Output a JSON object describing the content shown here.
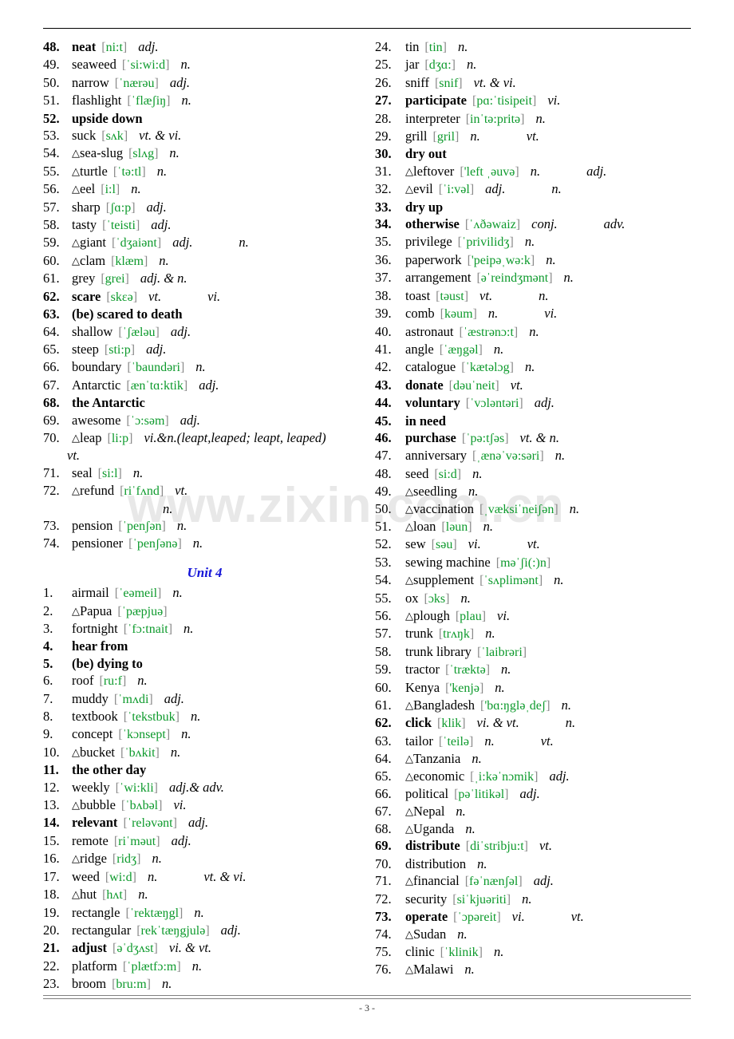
{
  "page": {
    "footer_number": "- 3 -",
    "watermark": "www.zixin.com.cn",
    "unit_heading": "Unit 4",
    "accent_green": "#0d9a2c",
    "bracket_gray": "#8a8a8a",
    "unit_blue": "#1414d8"
  },
  "left_column": [
    {
      "num": "48.",
      "tri": false,
      "bold": true,
      "word": "neat",
      "phon": "[ni:t]",
      "pos": "adj."
    },
    {
      "num": "49.",
      "tri": false,
      "bold": false,
      "word": "seaweed",
      "phon": "[ˈsi:wi:d]",
      "pos": "n."
    },
    {
      "num": "50.",
      "tri": false,
      "bold": false,
      "word": "narrow",
      "phon": "[ˈnærəu]",
      "pos": "adj."
    },
    {
      "num": "51.",
      "tri": false,
      "bold": false,
      "word": "flashlight",
      "phon": "[ˈflæʃiŋ]",
      "pos": "n."
    },
    {
      "num": "52.",
      "tri": false,
      "bold": true,
      "word": "upside down",
      "phon": "",
      "pos": ""
    },
    {
      "num": "53.",
      "tri": false,
      "bold": false,
      "word": "suck",
      "phon": "[sʌk]",
      "pos": "vt. & vi."
    },
    {
      "num": "54.",
      "tri": true,
      "bold": false,
      "word": "sea-slug",
      "phon": "[slʌg]",
      "pos": "n."
    },
    {
      "num": "55.",
      "tri": true,
      "bold": false,
      "word": "turtle",
      "phon": "[ˈtə:tl]",
      "pos": "n."
    },
    {
      "num": "56.",
      "tri": true,
      "bold": false,
      "word": "eel",
      "phon": "[i:l]",
      "pos": "n."
    },
    {
      "num": "57.",
      "tri": false,
      "bold": false,
      "word": "sharp",
      "phon": "[ʃɑ:p]",
      "pos": "adj."
    },
    {
      "num": "58.",
      "tri": false,
      "bold": false,
      "word": "tasty",
      "phon": "[ˈteisti]",
      "pos": "adj."
    },
    {
      "num": "59.",
      "tri": true,
      "bold": false,
      "word": "giant",
      "phon": "[ˈdʒaiənt]",
      "pos": "adj.",
      "pos2": "n."
    },
    {
      "num": "60.",
      "tri": true,
      "bold": false,
      "word": "clam",
      "phon": "[klæm]",
      "pos": "n."
    },
    {
      "num": "61.",
      "tri": false,
      "bold": false,
      "word": "grey",
      "phon": "[grei]",
      "pos": "adj. & n."
    },
    {
      "num": "62.",
      "tri": false,
      "bold": true,
      "word": "scare",
      "phon": "[skɛə]",
      "pos": "vt.",
      "pos2": "vi."
    },
    {
      "num": "63.",
      "tri": false,
      "bold": true,
      "word": "(be) scared to death",
      "phon": "",
      "pos": ""
    },
    {
      "num": "64.",
      "tri": false,
      "bold": false,
      "word": "shallow",
      "phon": "[ˈʃæləu]",
      "pos": "adj."
    },
    {
      "num": "65.",
      "tri": false,
      "bold": false,
      "word": "steep",
      "phon": "[sti:p]",
      "pos": "adj."
    },
    {
      "num": "66.",
      "tri": false,
      "bold": false,
      "word": "boundary",
      "phon": "[ˈbaundəri]",
      "pos": "n."
    },
    {
      "num": "67.",
      "tri": false,
      "bold": false,
      "word": "Antarctic",
      "phon": "[ænˈtɑ:ktik]",
      "pos": "adj."
    },
    {
      "num": "68.",
      "tri": false,
      "bold": true,
      "word": "the Antarctic",
      "phon": "",
      "pos": ""
    },
    {
      "num": "69.",
      "tri": false,
      "bold": false,
      "word": "awesome",
      "phon": "[ˈɔ:səm]",
      "pos": "adj."
    },
    {
      "num": "70.",
      "tri": true,
      "bold": false,
      "word": "leap",
      "phon": "[li:p]",
      "pos": "vi.&n.(leapt,leaped; leapt, leaped)",
      "cont": "vt.",
      "cont_indent": "i1"
    },
    {
      "num": "71.",
      "tri": false,
      "bold": false,
      "word": "seal",
      "phon": "[si:l]",
      "pos": "n."
    },
    {
      "num": "72.",
      "tri": true,
      "bold": false,
      "word": "refund",
      "phon": "[riˈfʌnd]",
      "pos": "vt.",
      "cont": "n.",
      "cont_indent": "i2"
    },
    {
      "num": "73.",
      "tri": false,
      "bold": false,
      "word": "pension",
      "phon": "[ˈpenʃən]",
      "pos": "n."
    },
    {
      "num": "74.",
      "tri": false,
      "bold": false,
      "word": "pensioner",
      "phon": "[ˈpenʃənə]",
      "pos": "n."
    }
  ],
  "left_column_unit4": [
    {
      "num": "1.",
      "tri": false,
      "bold": false,
      "word": "airmail",
      "phon": "[ˈeəmeil]",
      "pos": "n."
    },
    {
      "num": "2.",
      "tri": true,
      "bold": false,
      "word": "Papua",
      "phon": "[ˈpæpjuə]",
      "pos": ""
    },
    {
      "num": "3.",
      "tri": false,
      "bold": false,
      "word": "fortnight",
      "phon": "[ˈfɔ:tnait]",
      "pos": "n."
    },
    {
      "num": "4.",
      "tri": false,
      "bold": true,
      "word": "hear from",
      "phon": "",
      "pos": ""
    },
    {
      "num": "5.",
      "tri": false,
      "bold": true,
      "word": "(be) dying to",
      "phon": "",
      "pos": ""
    },
    {
      "num": "6.",
      "tri": false,
      "bold": false,
      "word": "roof",
      "phon": "[ru:f]",
      "pos": "n."
    },
    {
      "num": "7.",
      "tri": false,
      "bold": false,
      "word": "muddy",
      "phon": "[ˈmʌdi]",
      "pos": "adj."
    },
    {
      "num": "8.",
      "tri": false,
      "bold": false,
      "word": "textbook",
      "phon": "[ˈtekstbuk]",
      "pos": "n."
    },
    {
      "num": "9.",
      "tri": false,
      "bold": false,
      "word": "concept",
      "phon": "[ˈkɔnsept]",
      "pos": "n."
    },
    {
      "num": "10.",
      "tri": true,
      "bold": false,
      "word": "bucket",
      "phon": "[ˈbʌkit]",
      "pos": "n."
    },
    {
      "num": "11.",
      "tri": false,
      "bold": true,
      "word": "the other day",
      "phon": "",
      "pos": ""
    },
    {
      "num": "12.",
      "tri": false,
      "bold": false,
      "word": "weekly",
      "phon": "[ˈwi:kli]",
      "pos": "adj.& adv."
    },
    {
      "num": "13.",
      "tri": true,
      "bold": false,
      "word": "bubble",
      "phon": "[ˈbʌbəl]",
      "pos": "vi."
    },
    {
      "num": "14.",
      "tri": false,
      "bold": true,
      "word": "relevant",
      "phon": "[ˈreləvənt]",
      "pos": "adj."
    },
    {
      "num": "15.",
      "tri": false,
      "bold": false,
      "word": "remote",
      "phon": "[riˈməut]",
      "pos": "adj."
    },
    {
      "num": "16.",
      "tri": true,
      "bold": false,
      "word": "ridge",
      "phon": "[ridʒ]",
      "pos": "n."
    },
    {
      "num": "17.",
      "tri": false,
      "bold": false,
      "word": "weed",
      "phon": "[wi:d]",
      "pos": "n.",
      "pos2": "vt. & vi."
    },
    {
      "num": "18.",
      "tri": true,
      "bold": false,
      "word": "hut",
      "phon": "[hʌt]",
      "pos": "n."
    },
    {
      "num": "19.",
      "tri": false,
      "bold": false,
      "word": "rectangle",
      "phon": "[ˈrektæŋgl]",
      "pos": "n."
    },
    {
      "num": "20.",
      "tri": false,
      "bold": false,
      "word": "rectangular",
      "phon": "[rekˈtæŋgjulə]",
      "pos": "adj."
    },
    {
      "num": "21.",
      "tri": false,
      "bold": true,
      "word": "adjust",
      "phon": "[əˈdʒʌst]",
      "pos": "vi. & vt."
    },
    {
      "num": "22.",
      "tri": false,
      "bold": false,
      "word": "platform",
      "phon": "[ˈplætfɔ:m]",
      "pos": "n."
    },
    {
      "num": "23.",
      "tri": false,
      "bold": false,
      "word": "broom",
      "phon": "[bru:m]",
      "pos": "n."
    }
  ],
  "right_column": [
    {
      "num": "24.",
      "tri": false,
      "bold": false,
      "word": "tin",
      "phon": "[tin]",
      "pos": "n."
    },
    {
      "num": "25.",
      "tri": false,
      "bold": false,
      "word": "jar",
      "phon": "[dʒɑ:]",
      "pos": "n."
    },
    {
      "num": "26.",
      "tri": false,
      "bold": false,
      "word": "sniff",
      "phon": "[snif]",
      "pos": "vt. & vi."
    },
    {
      "num": "27.",
      "tri": false,
      "bold": true,
      "word": "participate",
      "phon": "[pɑ:ˈtisipeit]",
      "pos": "vi."
    },
    {
      "num": "28.",
      "tri": false,
      "bold": false,
      "word": "interpreter",
      "phon": "[inˈtə:pritə]",
      "pos": "n."
    },
    {
      "num": "29.",
      "tri": false,
      "bold": false,
      "word": "grill",
      "phon": "[gril]",
      "pos": "n.",
      "pos2": "vt."
    },
    {
      "num": "30.",
      "tri": false,
      "bold": true,
      "word": "dry   out",
      "phon": "",
      "pos": ""
    },
    {
      "num": "31.",
      "tri": true,
      "bold": false,
      "word": "leftover",
      "phon": "['left ˌəuvə]",
      "pos": "n.",
      "pos2": "adj."
    },
    {
      "num": "32.",
      "tri": true,
      "bold": false,
      "word": "evil",
      "phon": "[ˈi:vəl]",
      "pos": "adj.",
      "pos2": "n."
    },
    {
      "num": "33.",
      "tri": false,
      "bold": true,
      "word": "dry up",
      "phon": "",
      "pos": ""
    },
    {
      "num": "34.",
      "tri": false,
      "bold": true,
      "word": "otherwise",
      "phon": "[ˈʌðəwaiz]",
      "pos": "conj.",
      "pos2": "adv."
    },
    {
      "num": "35.",
      "tri": false,
      "bold": false,
      "word": "privilege",
      "phon": "[ˈprivilidʒ]",
      "pos": "n."
    },
    {
      "num": "36.",
      "tri": false,
      "bold": false,
      "word": "paperwork",
      "phon": "['peipəˌwə:k]",
      "pos": "n."
    },
    {
      "num": "37.",
      "tri": false,
      "bold": false,
      "word": "arrangement",
      "phon": "[əˈreindʒmənt]",
      "pos": "n."
    },
    {
      "num": "38.",
      "tri": false,
      "bold": false,
      "word": "toast",
      "phon": "[təust]",
      "pos": "vt.",
      "pos2": "n."
    },
    {
      "num": "39.",
      "tri": false,
      "bold": false,
      "word": "comb",
      "phon": "[kəum]",
      "pos": "n.",
      "pos2": "vi."
    },
    {
      "num": "40.",
      "tri": false,
      "bold": false,
      "word": "astronaut",
      "phon": "[ˈæstrənɔ:t]",
      "pos": "n."
    },
    {
      "num": "41.",
      "tri": false,
      "bold": false,
      "word": "angle",
      "phon": "[ˈæŋgəl]",
      "pos": "n."
    },
    {
      "num": "42.",
      "tri": false,
      "bold": false,
      "word": "catalogue",
      "phon": "[ˈkætəlɔg]",
      "pos": "n."
    },
    {
      "num": "43.",
      "tri": false,
      "bold": true,
      "word": "donate",
      "phon": "[dəuˈneit]",
      "pos": "vt."
    },
    {
      "num": "44.",
      "tri": false,
      "bold": true,
      "word": "voluntary",
      "phon": "[ˈvɔləntəri]",
      "pos": "adj."
    },
    {
      "num": "45.",
      "tri": false,
      "bold": true,
      "word": "in need",
      "phon": "",
      "pos": ""
    },
    {
      "num": "46.",
      "tri": false,
      "bold": true,
      "word": "purchase",
      "phon": "[ˈpə:tʃəs]",
      "pos": "vt. & n."
    },
    {
      "num": "47.",
      "tri": false,
      "bold": false,
      "word": "anniversary",
      "phon": "[ˌænəˈvə:səri]",
      "pos": "n."
    },
    {
      "num": "48.",
      "tri": false,
      "bold": false,
      "word": "seed",
      "phon": "[si:d]",
      "pos": "n."
    },
    {
      "num": "49.",
      "tri": true,
      "bold": false,
      "word": "seedling",
      "phon": "",
      "pos": "n."
    },
    {
      "num": "50.",
      "tri": true,
      "bold": false,
      "word": "vaccination",
      "phon": "[ˌvæksiˈneiʃən]",
      "pos": "n."
    },
    {
      "num": "51.",
      "tri": true,
      "bold": false,
      "word": "loan",
      "phon": "[ləun]",
      "pos": "n."
    },
    {
      "num": "52.",
      "tri": false,
      "bold": false,
      "word": "sew",
      "phon": "[səu]",
      "pos": "vi.",
      "pos2": "vt."
    },
    {
      "num": "53.",
      "tri": false,
      "bold": false,
      "word": "sewing machine",
      "phon": "[məˈʃi(:)n]",
      "pos": ""
    },
    {
      "num": "54.",
      "tri": true,
      "bold": false,
      "word": "supplement",
      "phon": "[ˈsʌplimənt]",
      "pos": "n."
    },
    {
      "num": "55.",
      "tri": false,
      "bold": false,
      "word": "ox",
      "phon": "[ɔks]",
      "pos": "n."
    },
    {
      "num": "56.",
      "tri": true,
      "bold": false,
      "word": "plough",
      "phon": "[plau]",
      "pos": "vi."
    },
    {
      "num": "57.",
      "tri": false,
      "bold": false,
      "word": "trunk",
      "phon": "[trʌŋk]",
      "pos": "n."
    },
    {
      "num": "58.",
      "tri": false,
      "bold": false,
      "word": "trunk library",
      "phon": "[ˈlaibrəri]",
      "pos": ""
    },
    {
      "num": "59.",
      "tri": false,
      "bold": false,
      "word": "tractor",
      "phon": "[ˈtræktə]",
      "pos": "n."
    },
    {
      "num": "60.",
      "tri": false,
      "bold": false,
      "word": "Kenya",
      "phon": "['kenjə]",
      "pos": "n."
    },
    {
      "num": "61.",
      "tri": true,
      "bold": false,
      "word": "Bangladesh",
      "phon": "['bɑ:ŋgləˌdeʃ]",
      "pos": "n."
    },
    {
      "num": "62.",
      "tri": false,
      "bold": true,
      "word": "click",
      "phon": "[klik]",
      "pos": "vi. & vt.",
      "pos2": "n."
    },
    {
      "num": "63.",
      "tri": false,
      "bold": false,
      "word": "tailor",
      "phon": "[ˈteilə]",
      "pos": "n.",
      "pos2": "vt."
    },
    {
      "num": "64.",
      "tri": true,
      "bold": false,
      "word": "Tanzania",
      "phon": "",
      "pos": "n."
    },
    {
      "num": "65.",
      "tri": true,
      "bold": false,
      "word": "economic",
      "phon": "[ˌi:kəˈnɔmik]",
      "pos": "adj."
    },
    {
      "num": "66.",
      "tri": false,
      "bold": false,
      "word": "political",
      "phon": "[pəˈlitikəl]",
      "pos": "adj."
    },
    {
      "num": "67.",
      "tri": true,
      "bold": false,
      "word": "Nepal",
      "phon": "",
      "pos": "n."
    },
    {
      "num": "68.",
      "tri": true,
      "bold": false,
      "word": "Uganda",
      "phon": "",
      "pos": "n."
    },
    {
      "num": "69.",
      "tri": false,
      "bold": true,
      "word": "distribute",
      "phon": "[diˈstribju:t]",
      "pos": "vt."
    },
    {
      "num": "70.",
      "tri": false,
      "bold": false,
      "word": "distribution",
      "phon": "",
      "pos": "n."
    },
    {
      "num": "71.",
      "tri": true,
      "bold": false,
      "word": "financial",
      "phon": "[fəˈnænʃəl]",
      "pos": "adj."
    },
    {
      "num": "72.",
      "tri": false,
      "bold": false,
      "word": "security",
      "phon": "[siˈkjuəriti]",
      "pos": "n."
    },
    {
      "num": "73.",
      "tri": false,
      "bold": true,
      "word": "operate",
      "phon": "[ˈɔpəreit]",
      "pos": "vi.",
      "pos2": "vt."
    },
    {
      "num": "74.",
      "tri": true,
      "bold": false,
      "word": "Sudan",
      "phon": "",
      "pos": "n."
    },
    {
      "num": "75.",
      "tri": false,
      "bold": false,
      "word": "clinic",
      "phon": "[ˈklinik]",
      "pos": "n."
    },
    {
      "num": "76.",
      "tri": true,
      "bold": false,
      "word": "Malawi",
      "phon": "",
      "pos": "n."
    }
  ]
}
